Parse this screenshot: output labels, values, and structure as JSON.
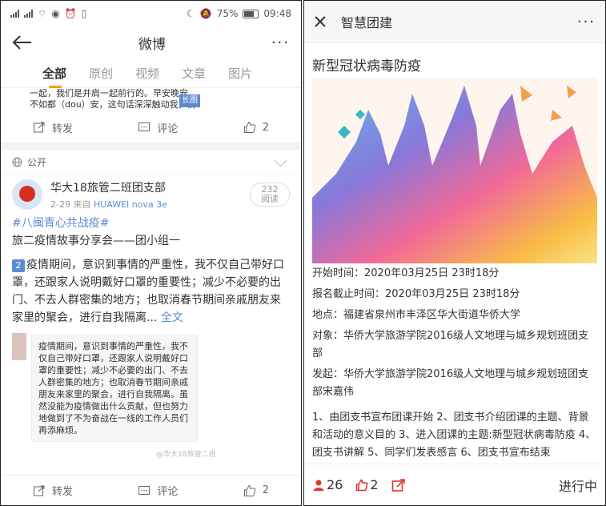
{
  "left": {
    "status": {
      "battery": "75%",
      "time": "09:48"
    },
    "header": {
      "title": "微博",
      "more": "···"
    },
    "tabs": [
      "全部",
      "原创",
      "视频",
      "文章",
      "图片"
    ],
    "cut_text": {
      "line1": "一起，我们是并肩一起前行的。早安晚安",
      "line2": "不如都（dou）安，这句话深深触动我，前",
      "badge": "长图"
    },
    "actions1": {
      "repost": "转发",
      "comment": "评论",
      "like": "2"
    },
    "public_label": "公开",
    "post": {
      "name": "华大18旅管二班团支部",
      "date": "2-29",
      "source_prefix": "来自",
      "device": "HUAWEI nova 3e",
      "read_count": "232",
      "read_label": "阅读",
      "hashtag": "#八闽青心共战疫#",
      "subtitle": "旅二疫情故事分享会——团小组一",
      "num": "2",
      "body": "疫情期间，意识到事情的严重性，我不仅自己带好口罩，还跟家人说明戴好口罩的重要性；减少不必要的出门、不去人群密集的地方；也取消春节期间亲戚朋友来家里的聚会，进行自我隔离...",
      "more": "全文",
      "card_text": "疫情期间，意识到事情的严重性，我不仅自己带好口罩，还跟家人说明戴好口罩的重要性；减少不必要的出门、不去人群密集的地方；也取消春节期间亲戚朋友来家里的聚会，进行自我隔离。虽然没能为疫情做出什么贡献，但也努力地做到了不为奋战在一线的工作人员们再添麻烦。",
      "watermark": "@华大18旅管二班"
    },
    "actions2": {
      "repost": "转发",
      "comment": "评论",
      "like": "2"
    }
  },
  "right": {
    "header": {
      "title": "智慧团建",
      "more": "···"
    },
    "topic": "新型冠状病毒防疫",
    "info": [
      {
        "label": "开始时间：",
        "value": "2020年03月25日 23时18分"
      },
      {
        "label": "报名截止时间：",
        "value": "2020年03月25日 23时18分"
      },
      {
        "label": "地点：",
        "value": "福建省泉州市丰泽区华大街道华侨大学"
      },
      {
        "label": "对象：",
        "value": "华侨大学旅游学院2016级人文地理与城乡规划班团支部"
      },
      {
        "label": "发起：",
        "value": "华侨大学旅游学院2016级人文地理与城乡规划班团支部宋嘉伟"
      }
    ],
    "description": "1、由团支书宣布团课开始 2、团支书介绍团课的主题、背景和活动的意义目的 3、进入团课的主题:新型冠状病毒防疫 4、团支书讲解 5、同学们发表感言 6、团支书宣布结束",
    "footer": {
      "participants": "26",
      "likes": "2",
      "status": "进行中"
    },
    "colors": {
      "accent_red": "#e0322f"
    }
  }
}
